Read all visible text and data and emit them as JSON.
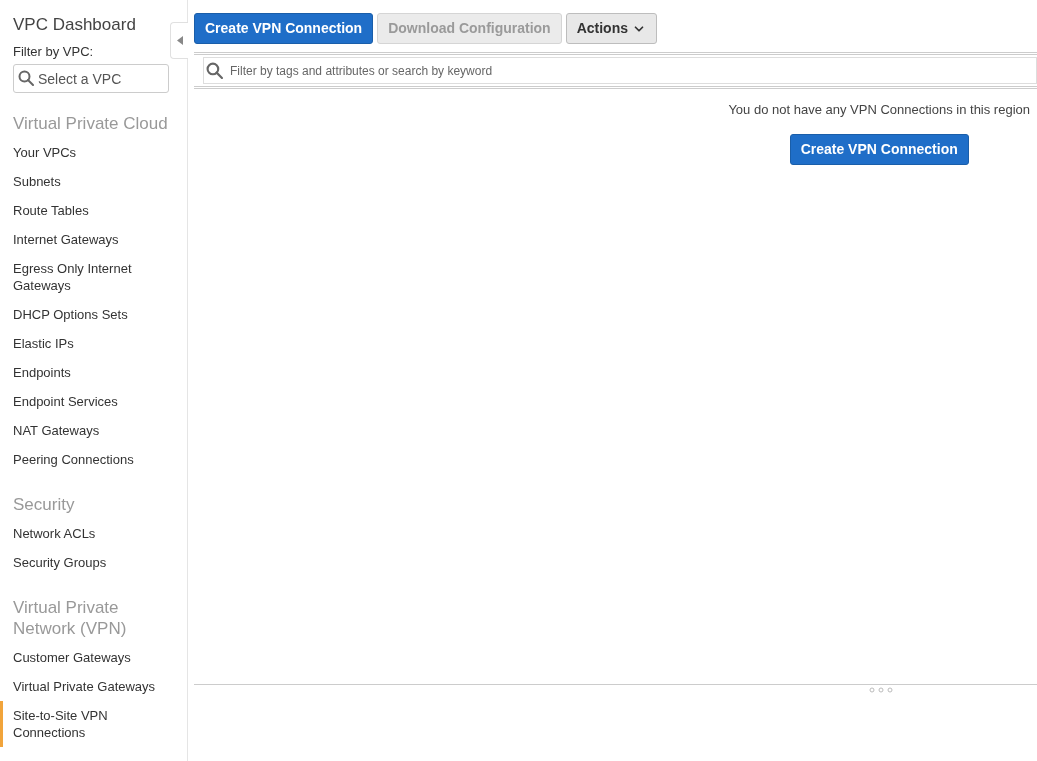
{
  "sidebar": {
    "title": "VPC Dashboard",
    "filter_label": "Filter by VPC:",
    "filter": {
      "placeholder": "Select a VPC"
    },
    "sections": [
      {
        "heading": "Virtual Private Cloud",
        "items": [
          {
            "label": "Your VPCs",
            "selected": false
          },
          {
            "label": "Subnets",
            "selected": false
          },
          {
            "label": "Route Tables",
            "selected": false
          },
          {
            "label": "Internet Gateways",
            "selected": false
          },
          {
            "label": "Egress Only Internet Gateways",
            "selected": false
          },
          {
            "label": "DHCP Options Sets",
            "selected": false
          },
          {
            "label": "Elastic IPs",
            "selected": false
          },
          {
            "label": "Endpoints",
            "selected": false
          },
          {
            "label": "Endpoint Services",
            "selected": false
          },
          {
            "label": "NAT Gateways",
            "selected": false
          },
          {
            "label": "Peering Connections",
            "selected": false
          }
        ]
      },
      {
        "heading": "Security",
        "items": [
          {
            "label": "Network ACLs",
            "selected": false
          },
          {
            "label": "Security Groups",
            "selected": false
          }
        ]
      },
      {
        "heading": "Virtual Private Network (VPN)",
        "items": [
          {
            "label": "Customer Gateways",
            "selected": false
          },
          {
            "label": "Virtual Private Gateways",
            "selected": false
          },
          {
            "label": "Site-to-Site VPN Connections",
            "selected": true
          }
        ]
      }
    ]
  },
  "toolbar": [
    {
      "label": "Create VPN Connection",
      "kind": "primary",
      "disabled": false
    },
    {
      "label": "Download Configuration",
      "kind": "default",
      "disabled": true
    },
    {
      "label": "Actions",
      "kind": "dropdown",
      "disabled": false
    }
  ],
  "search": {
    "placeholder": "Filter by tags and attributes or search by keyword"
  },
  "empty_state": {
    "message": "You do not have any VPN Connections in this region",
    "button": "Create VPN Connection"
  }
}
